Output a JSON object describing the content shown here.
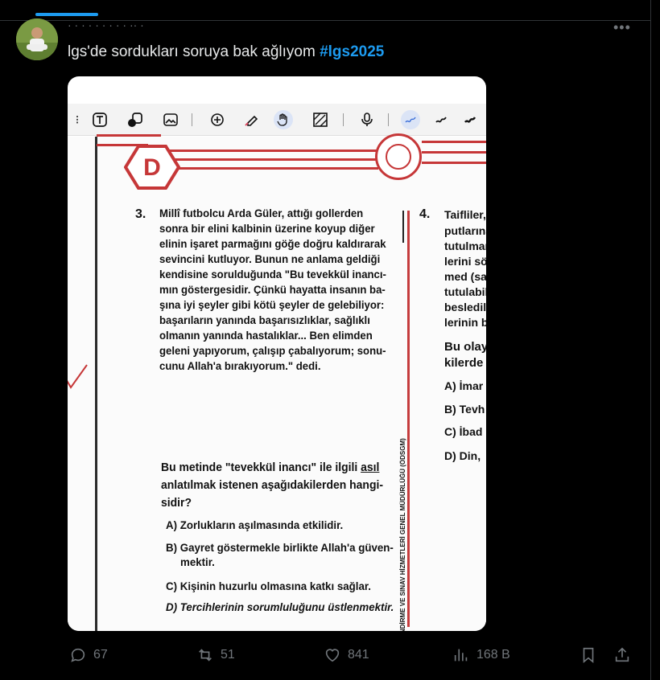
{
  "tweet": {
    "header_partial": "· ·  ·  ·   ·      ·  ·   ·       · ··  ·",
    "more_label": "•••",
    "text_main": "lgs'de sordukları soruya bak ağlıyom ",
    "hashtag": "#lgs2025"
  },
  "image": {
    "badge_letter": "D",
    "question": {
      "number": "3.",
      "lines": [
        "Millî futbolcu Arda Güler, attığı gollerden",
        "sonra bir elini kalbinin üzerine koyup diğer",
        "elinin işaret parmağını göğe doğru kaldırarak",
        "sevincini kutluyor. Bunun ne anlama geldiği",
        "kendisine sorulduğunda \"Bu tevekkül inancı-",
        "mın göstergesidir. Çünkü hayatta insanın ba-",
        "şına iyi şeyler gibi kötü şeyler de gelebiliyor:",
        "başarıların yanında başarısızlıklar, sağlıklı",
        "olmanın yanında hastalıklar... Ben elimden",
        "geleni yapıyorum, çalışıp çabalıyorum; sonu-",
        "cunu Allah'a bırakıyorum.\" dedi."
      ],
      "prompt_line1": "Bu metinde \"tevekkül inancı\" ile ilgili ",
      "prompt_underlined": "asıl",
      "prompt_line2": "anlatılmak istenen aşağıdakilerden hangi-",
      "prompt_line3": "sidir?",
      "options": {
        "a": "A) Zorlukların aşılmasında etkilidir.",
        "b1": "B) Gayret göstermekle birlikte Allah'a güven-",
        "b2": "mektir.",
        "c": "C) Kişinin huzurlu olmasına katkı sağlar.",
        "d": "D) Tercihlerinin sorumluluğunu üstlenmektir."
      }
    },
    "vertical_footer": "ÖLÇME, DEĞERLENDİRME VE SINAV HİZMETLERİ GENEL MÜDÜRLÜĞÜ (ÖDSGM)",
    "question4": {
      "number": "4.",
      "line1": "Taifliler,",
      "line2": "putlarına",
      "line3": "tutulmar",
      "line4": "lerini sö",
      "line5": "med (sa",
      "line6": "tutulabil",
      "line7": "besledil",
      "line8": "lerinin b",
      "line9": "Bu olay",
      "line10": "kilerde",
      "opt_a": "A) İmar",
      "opt_b": "B) Tevh",
      "opt_c": "C) İbad",
      "opt_d": "D) Din,"
    }
  },
  "actions": {
    "replies": "67",
    "retweets": "51",
    "likes": "841",
    "views": "168 B"
  },
  "colors": {
    "accent": "#1d9bf0",
    "exam_red": "#c63738"
  }
}
